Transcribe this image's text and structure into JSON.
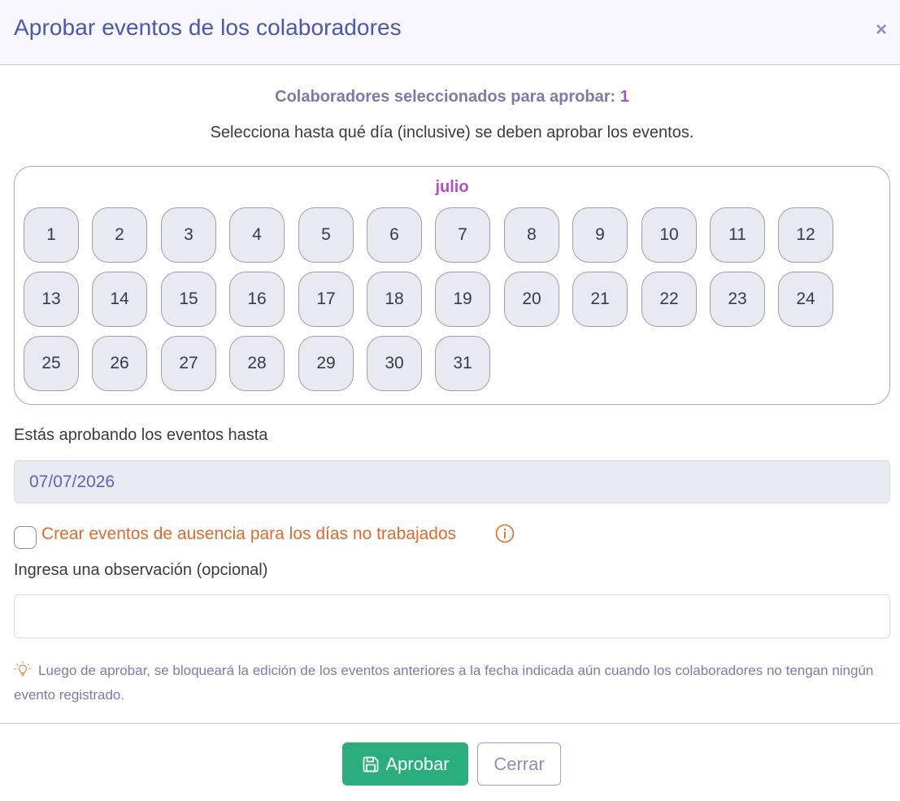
{
  "modal": {
    "title": "Aprobar eventos de los colaboradores",
    "close_symbol": "×"
  },
  "selection": {
    "label": "Colaboradores seleccionados para aprobar:",
    "count": "1",
    "instruction": "Selecciona hasta qué día (inclusive) se deben aprobar los eventos."
  },
  "calendar": {
    "month": "julio",
    "days": [
      "1",
      "2",
      "3",
      "4",
      "5",
      "6",
      "7",
      "8",
      "9",
      "10",
      "11",
      "12",
      "13",
      "14",
      "15",
      "16",
      "17",
      "18",
      "19",
      "20",
      "21",
      "22",
      "23",
      "24",
      "25",
      "26",
      "27",
      "28",
      "29",
      "30",
      "31"
    ]
  },
  "approval": {
    "until_label": "Estás aprobando los eventos hasta",
    "date_value": "07/07/2026"
  },
  "absence": {
    "checkbox_label": "Crear eventos de ausencia para los días no trabajados",
    "checked": false,
    "info_icon": "info-circle-icon"
  },
  "observation": {
    "label": "Ingresa una observación (opcional)",
    "value": "",
    "placeholder": ""
  },
  "notice": {
    "icon": "lightbulb-icon",
    "text": "Luego de aprobar, se bloqueará la edición de los eventos anteriores a la fecha indicada aún cuando los colaboradores no tengan ningún evento registrado."
  },
  "footer": {
    "approve_label": "Aprobar",
    "approve_icon": "save-icon",
    "close_label": "Cerrar"
  },
  "colors": {
    "title": "#4a56b5",
    "accent_purple": "#b44ecf",
    "warning_orange": "#e06a2c",
    "approve_green": "#2aae7e"
  }
}
